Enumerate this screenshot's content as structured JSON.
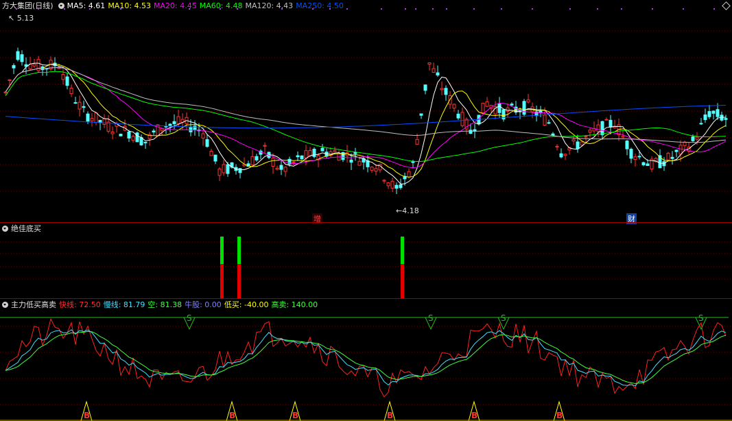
{
  "main": {
    "title": "方大集团(日线)",
    "indicators": [
      {
        "label": "MA5:",
        "value": "4.61",
        "color": "#ffffff"
      },
      {
        "label": "MA10:",
        "value": "4.53",
        "color": "#ffff00"
      },
      {
        "label": "MA20:",
        "value": "4.45",
        "color": "#ff00ff"
      },
      {
        "label": "MA60:",
        "value": "4.48",
        "color": "#00ff00"
      },
      {
        "label": "MA120:",
        "value": "4.43",
        "color": "#c0c0c0"
      },
      {
        "label": "MA250:",
        "value": "4.50",
        "color": "#0050ff"
      }
    ],
    "high_mark": "5.13",
    "low_mark": "4.18",
    "tags": [
      "增",
      "财"
    ],
    "colors": {
      "up": "#ff3232",
      "down": "#54ffff",
      "ma5": "#ffffff",
      "ma10": "#ffff00",
      "ma20": "#ff00ff",
      "ma60": "#00ff00",
      "ma120": "#c0c0c0",
      "ma250": "#0050ff"
    }
  },
  "panel2": {
    "title": "绝佳底买"
  },
  "panel3": {
    "title": "主力低买高卖",
    "indicators": [
      {
        "label": "快线:",
        "value": "72.50",
        "color": "#ff3030"
      },
      {
        "label": "慢线:",
        "value": "81.79",
        "color": "#40e0ff"
      },
      {
        "label": "空:",
        "value": "81.38",
        "color": "#40ff40"
      },
      {
        "label": "牛股:",
        "value": "0.00",
        "color": "#8080ff"
      },
      {
        "label": "低买:",
        "value": "-40.00",
        "color": "#ffff00"
      },
      {
        "label": "高卖:",
        "value": "140.00",
        "color": "#40ff40"
      }
    ],
    "sell_mark": "S",
    "buy_mark": "B"
  },
  "chart_data": {
    "type": "candlestick",
    "price_range": [
      4.18,
      5.13
    ],
    "ma_last": {
      "MA5": 4.61,
      "MA10": 4.53,
      "MA20": 4.45,
      "MA60": 4.48,
      "MA120": 4.43,
      "MA250": 4.5
    },
    "oscillator_last": {
      "fast": 72.5,
      "slow": 81.79,
      "kong": 81.38,
      "niugu": 0.0,
      "low_buy": -40.0,
      "high_sell": 140.0
    }
  }
}
